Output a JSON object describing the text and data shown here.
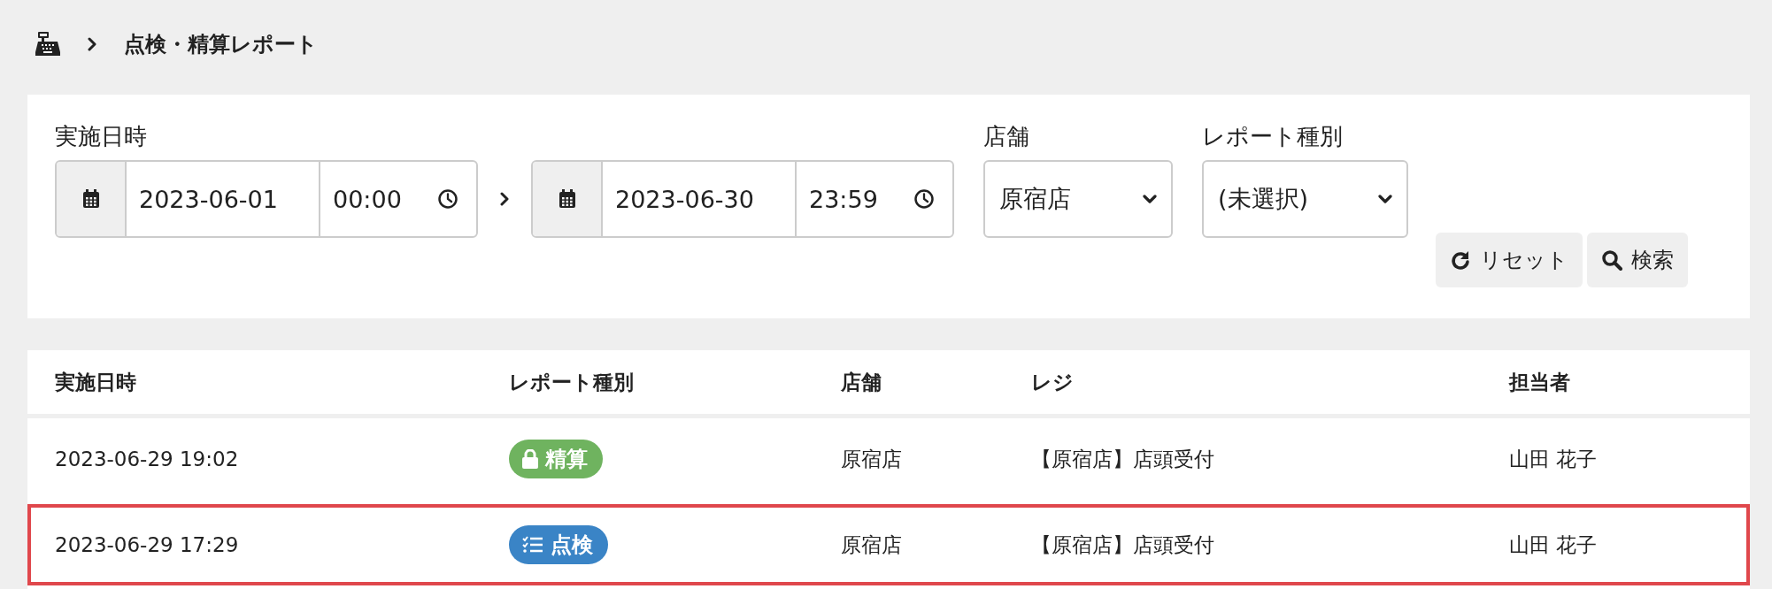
{
  "breadcrumb": {
    "title": "点検・精算レポート"
  },
  "filters": {
    "date_label": "実施日時",
    "from": {
      "date": "2023-06-01",
      "time": "00:00"
    },
    "to": {
      "date": "2023-06-30",
      "time": "23:59"
    },
    "store": {
      "label": "店舗",
      "value": "原宿店"
    },
    "report_type": {
      "label": "レポート種別",
      "value": "(未選択)"
    },
    "buttons": [
      {
        "kind": "reset",
        "label": "リセット"
      },
      {
        "kind": "search",
        "label": "検索"
      }
    ]
  },
  "table": {
    "columns": [
      "実施日時",
      "レポート種別",
      "店舗",
      "レジ",
      "担当者"
    ],
    "rows": [
      {
        "datetime": "2023-06-29 19:02",
        "type": {
          "kind": "settlement",
          "label": "精算"
        },
        "store": "原宿店",
        "register": "【原宿店】店頭受付",
        "staff": "山田 花子",
        "highlighted": false
      },
      {
        "datetime": "2023-06-29 17:29",
        "type": {
          "kind": "inspection",
          "label": "点検"
        },
        "store": "原宿店",
        "register": "【原宿店】店頭受付",
        "staff": "山田 花子",
        "highlighted": true
      }
    ]
  }
}
